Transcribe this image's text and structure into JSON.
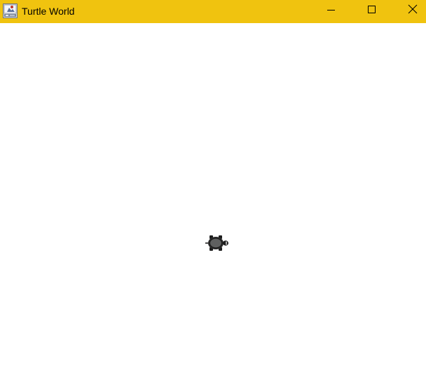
{
  "window": {
    "title": "Turtle World",
    "titlebar_color": "#f0c30f",
    "app_icon": "java-app-icon",
    "controls": {
      "minimize_icon": "minimize-icon",
      "maximize_icon": "maximize-icon",
      "close_icon": "close-icon"
    }
  },
  "canvas": {
    "background": "#ffffff",
    "turtle": {
      "icon": "turtle-icon",
      "heading": "east"
    }
  }
}
